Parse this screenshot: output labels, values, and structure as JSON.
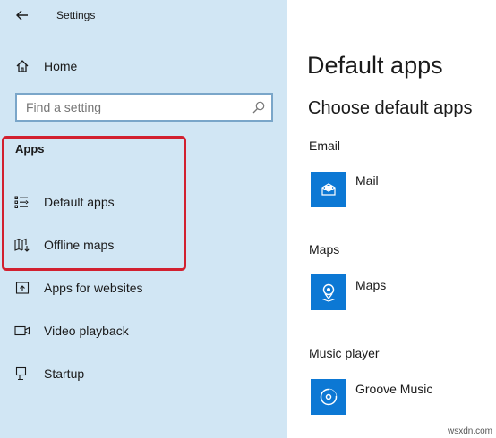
{
  "window": {
    "title": "Settings"
  },
  "sidebar": {
    "home_label": "Home",
    "search": {
      "placeholder": "Find a setting",
      "value": ""
    },
    "section_heading": "Apps",
    "items": [
      {
        "label": "Default apps",
        "icon": "default-apps-icon"
      },
      {
        "label": "Offline maps",
        "icon": "offline-maps-icon"
      },
      {
        "label": "Apps for websites",
        "icon": "apps-for-websites-icon"
      },
      {
        "label": "Video playback",
        "icon": "video-playback-icon"
      },
      {
        "label": "Startup",
        "icon": "startup-icon"
      }
    ],
    "highlight_color": "#d2202f",
    "background_color": "#d1e6f4"
  },
  "main": {
    "page_title": "Default apps",
    "sub_title": "Choose default apps",
    "categories": [
      {
        "label": "Email",
        "app": "Mail",
        "icon": "mail-icon"
      },
      {
        "label": "Maps",
        "app": "Maps",
        "icon": "maps-icon"
      },
      {
        "label": "Music player",
        "app": "Groove Music",
        "icon": "groove-music-icon"
      }
    ],
    "tile_color": "#0c78d4"
  },
  "watermark": "wsxdn.com"
}
